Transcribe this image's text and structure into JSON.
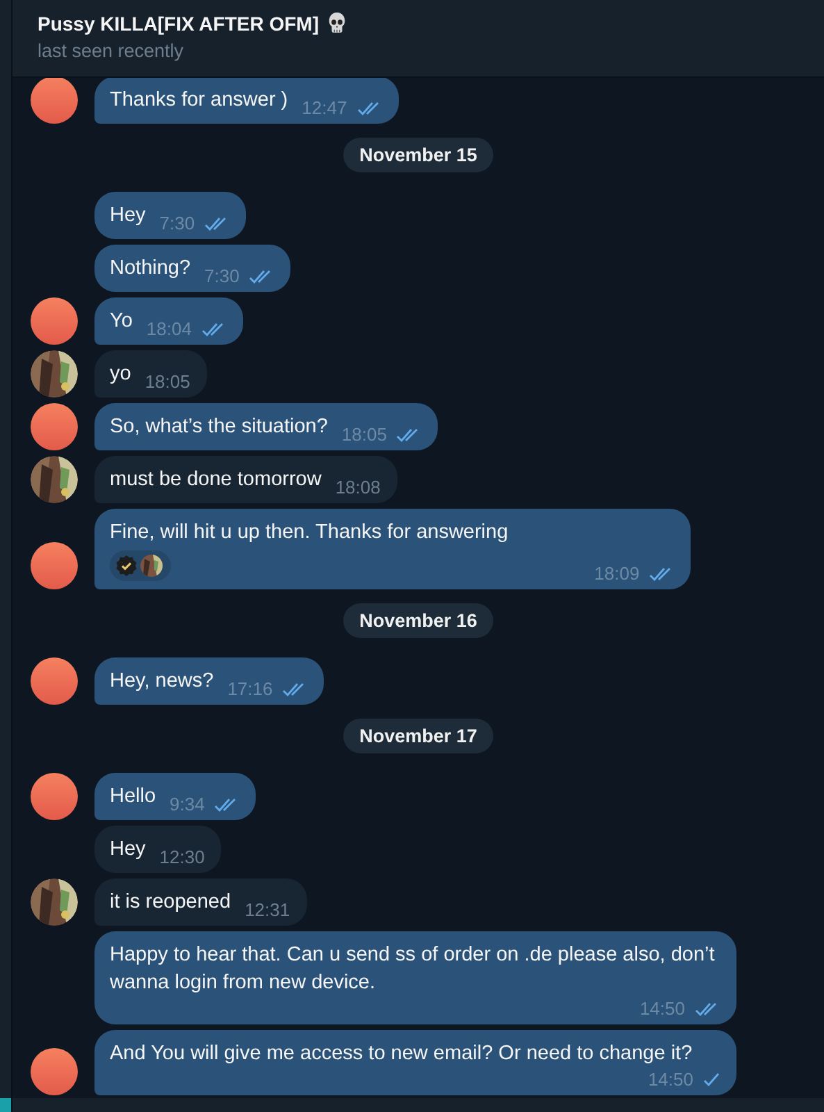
{
  "chat": {
    "title": "Pussy KILLA[FIX AFTER OFM]",
    "status": "last seen recently"
  },
  "items": [
    {
      "kind": "message",
      "outgoing": true,
      "text": "Thanks for answer )",
      "time": "12:47",
      "read": true
    },
    {
      "kind": "date",
      "text": "November 15"
    },
    {
      "kind": "message",
      "outgoing": true,
      "text": "Hey",
      "time": "7:30",
      "read": true
    },
    {
      "kind": "message",
      "outgoing": true,
      "text": "Nothing?",
      "time": "7:30",
      "read": true
    },
    {
      "kind": "message",
      "outgoing": true,
      "text": "Yo",
      "time": "18:04",
      "read": true
    },
    {
      "kind": "message",
      "outgoing": false,
      "text": "yo",
      "time": "18:05"
    },
    {
      "kind": "message",
      "outgoing": true,
      "text": "So, what’s the situation?",
      "time": "18:05",
      "read": true
    },
    {
      "kind": "message",
      "outgoing": false,
      "text": "must be done tomorrow",
      "time": "18:08"
    },
    {
      "kind": "message",
      "outgoing": true,
      "text": "Fine, will hit u up then. Thanks for answering",
      "time": "18:09",
      "read": true,
      "reactions": [
        {
          "kind": "badge"
        },
        {
          "kind": "avatar"
        }
      ]
    },
    {
      "kind": "date",
      "text": "November 16"
    },
    {
      "kind": "message",
      "outgoing": true,
      "text": "Hey, news?",
      "time": "17:16",
      "read": true
    },
    {
      "kind": "date",
      "text": "November 17"
    },
    {
      "kind": "message",
      "outgoing": true,
      "text": "Hello",
      "time": "9:34",
      "read": true
    },
    {
      "kind": "message",
      "outgoing": false,
      "text": "Hey",
      "time": "12:30"
    },
    {
      "kind": "message",
      "outgoing": false,
      "text": "it is reopened",
      "time": "12:31"
    },
    {
      "kind": "message",
      "outgoing": true,
      "text": "Happy to hear that. Can u send ss of order on .de please also, don’t wanna login from new device.",
      "time": "14:50",
      "read": true
    },
    {
      "kind": "message",
      "outgoing": true,
      "text": "And You will give me access to new email? Or need to change it?",
      "time": "14:50",
      "read": false
    }
  ]
}
